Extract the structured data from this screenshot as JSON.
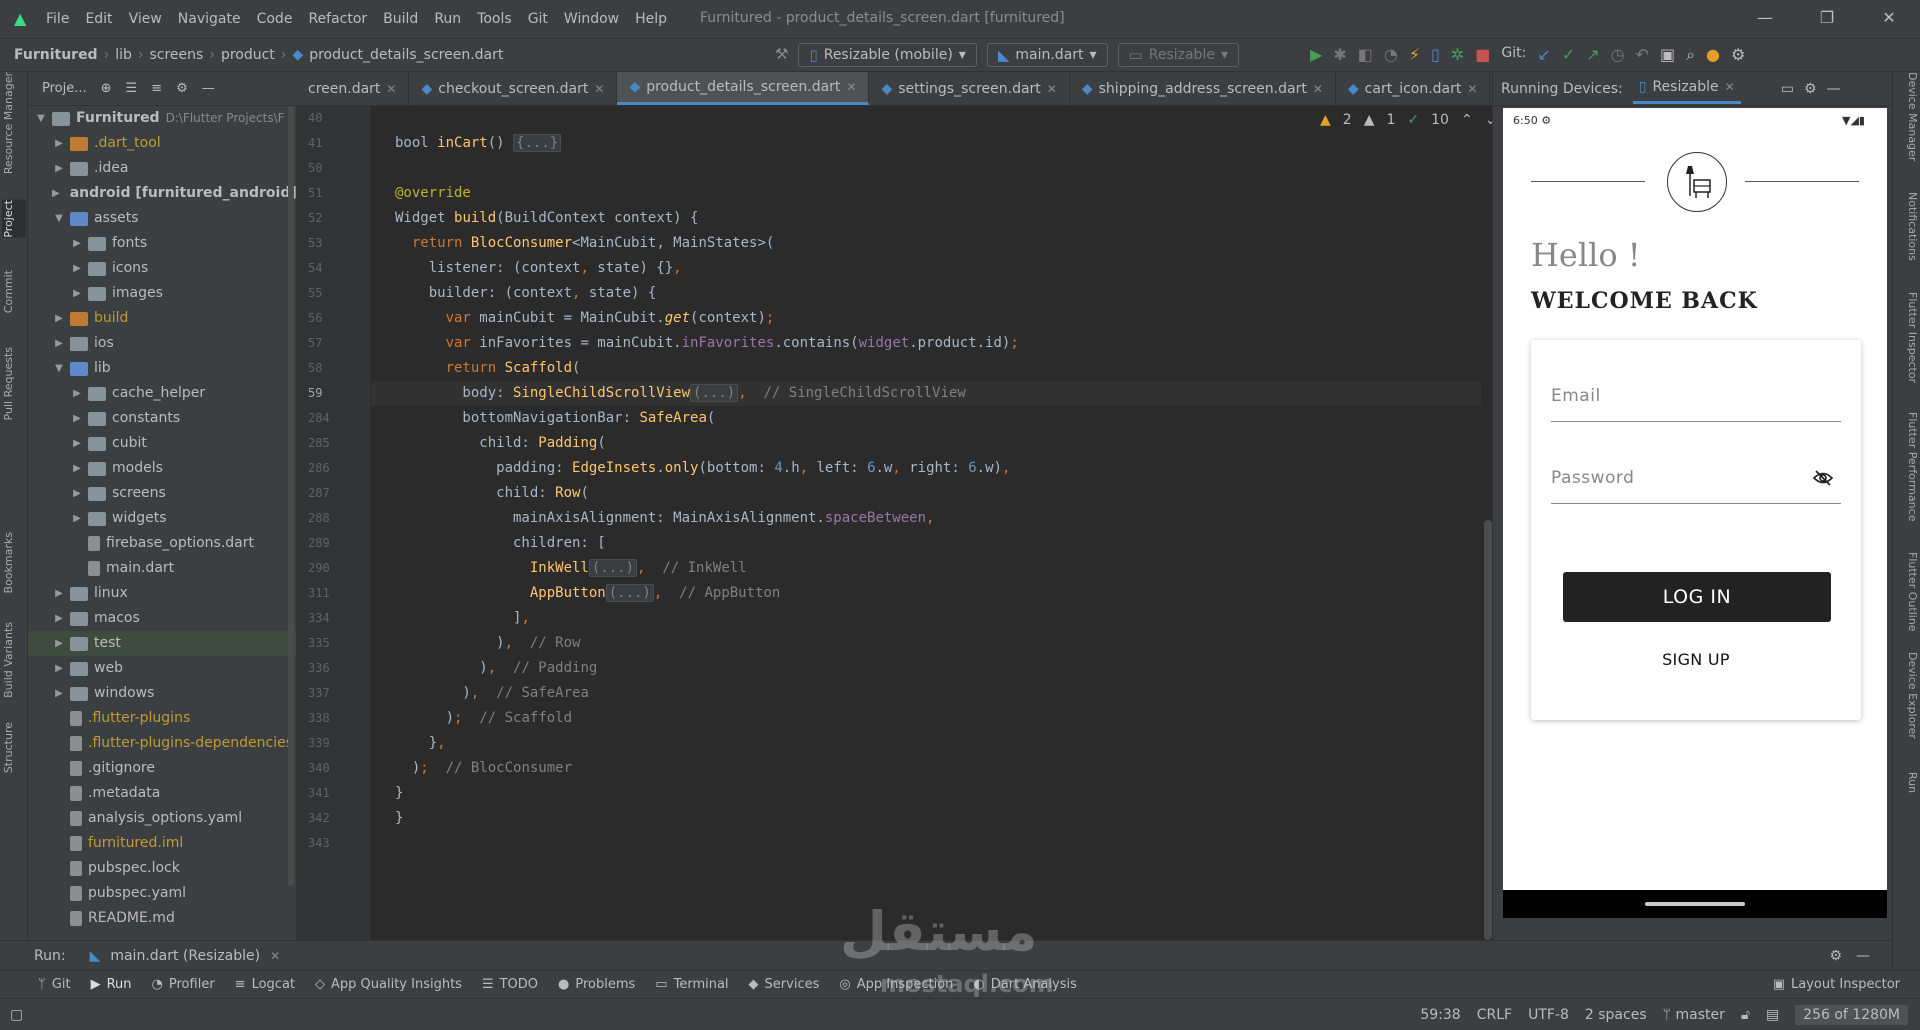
{
  "menu": [
    "File",
    "Edit",
    "View",
    "Navigate",
    "Code",
    "Refactor",
    "Build",
    "Run",
    "Tools",
    "Git",
    "Window",
    "Help"
  ],
  "window_title": "Furnitured - product_details_screen.dart [furnitured]",
  "breadcrumb": [
    "Furnitured",
    "lib",
    "screens",
    "product",
    "product_details_screen.dart"
  ],
  "toolbar": {
    "device": "Resizable (mobile)",
    "config": "main.dart",
    "device2": "Resizable",
    "git_label": "Git:"
  },
  "project_header": "Proje...",
  "tree": [
    {
      "label": "Furnitured",
      "extra": "D:\\Flutter Projects\\F",
      "indent": 0,
      "open": true,
      "bold": true
    },
    {
      "label": ".dart_tool",
      "indent": 1,
      "style": "yel"
    },
    {
      "label": ".idea",
      "indent": 1
    },
    {
      "label": "android [furnitured_android]",
      "indent": 1,
      "bold": true
    },
    {
      "label": "assets",
      "indent": 1,
      "open": true
    },
    {
      "label": "fonts",
      "indent": 2
    },
    {
      "label": "icons",
      "indent": 2
    },
    {
      "label": "images",
      "indent": 2
    },
    {
      "label": "build",
      "indent": 1,
      "style": "yel"
    },
    {
      "label": "ios",
      "indent": 1
    },
    {
      "label": "lib",
      "indent": 1,
      "open": true
    },
    {
      "label": "cache_helper",
      "indent": 2
    },
    {
      "label": "constants",
      "indent": 2
    },
    {
      "label": "cubit",
      "indent": 2
    },
    {
      "label": "models",
      "indent": 2
    },
    {
      "label": "screens",
      "indent": 2
    },
    {
      "label": "widgets",
      "indent": 2
    },
    {
      "label": "firebase_options.dart",
      "indent": 2,
      "file": true
    },
    {
      "label": "main.dart",
      "indent": 2,
      "file": true
    },
    {
      "label": "linux",
      "indent": 1
    },
    {
      "label": "macos",
      "indent": 1
    },
    {
      "label": "test",
      "indent": 1,
      "style": "hl"
    },
    {
      "label": "web",
      "indent": 1
    },
    {
      "label": "windows",
      "indent": 1
    },
    {
      "label": ".flutter-plugins",
      "indent": 1,
      "file": true,
      "style": "yel"
    },
    {
      "label": ".flutter-plugins-dependencies",
      "indent": 1,
      "file": true,
      "style": "yel"
    },
    {
      "label": ".gitignore",
      "indent": 1,
      "file": true
    },
    {
      "label": ".metadata",
      "indent": 1,
      "file": true
    },
    {
      "label": "analysis_options.yaml",
      "indent": 1,
      "file": true
    },
    {
      "label": "furnitured.iml",
      "indent": 1,
      "file": true,
      "style": "yel"
    },
    {
      "label": "pubspec.lock",
      "indent": 1,
      "file": true
    },
    {
      "label": "pubspec.yaml",
      "indent": 1,
      "file": true
    },
    {
      "label": "README.md",
      "indent": 1,
      "file": true
    }
  ],
  "tabs": [
    "creen.dart",
    "checkout_screen.dart",
    "product_details_screen.dart",
    "settings_screen.dart",
    "shipping_address_screen.dart",
    "cart_icon.dart"
  ],
  "active_tab": 2,
  "inspections": {
    "warn": "2",
    "weak": "1",
    "ok": "10"
  },
  "line_numbers": [
    "40",
    "41",
    "50",
    "51",
    "52",
    "53",
    "54",
    "55",
    "56",
    "57",
    "58",
    "59",
    "284",
    "285",
    "286",
    "287",
    "288",
    "289",
    "290",
    "311",
    "334",
    "335",
    "336",
    "337",
    "338",
    "339",
    "340",
    "341",
    "342",
    "343"
  ],
  "current_line": "59",
  "code_lines": [
    [],
    [
      [
        "",
        "bool "
      ],
      [
        "fn",
        "inCart"
      ],
      [
        "",
        "() "
      ],
      [
        "fold",
        "{...}"
      ]
    ],
    [],
    [
      [
        "an",
        "@override"
      ]
    ],
    [
      [
        "",
        "Widget "
      ],
      [
        "fn",
        "build"
      ],
      [
        "",
        "(BuildContext context) {"
      ]
    ],
    [
      [
        "",
        "  "
      ],
      [
        "kw",
        "return "
      ],
      [
        "fn",
        "BlocConsumer"
      ],
      [
        "",
        "<MainCubit, MainStates>("
      ]
    ],
    [
      [
        "",
        "    listener: (context"
      ],
      [
        "kw",
        ", "
      ],
      [
        "",
        "state) {}"
      ],
      [
        "kw",
        ","
      ]
    ],
    [
      [
        "",
        "    builder: (context"
      ],
      [
        "kw",
        ", "
      ],
      [
        "",
        "state) {"
      ]
    ],
    [
      [
        "",
        "      "
      ],
      [
        "kw",
        "var "
      ],
      [
        "",
        "mainCubit = MainCubit."
      ],
      [
        "mb",
        "get"
      ],
      [
        "",
        "(context)"
      ],
      [
        "kw",
        ";"
      ]
    ],
    [
      [
        "",
        "      "
      ],
      [
        "kw",
        "var "
      ],
      [
        "",
        "inFavorites = mainCubit."
      ],
      [
        "fd",
        "inFavorites"
      ],
      [
        "",
        ".contains("
      ],
      [
        "fd",
        "widget"
      ],
      [
        "",
        ".product.id)"
      ],
      [
        "kw",
        ";"
      ]
    ],
    [
      [
        "",
        "      "
      ],
      [
        "kw",
        "return "
      ],
      [
        "fn",
        "Scaffold"
      ],
      [
        "",
        "("
      ]
    ],
    [
      [
        "",
        "        body: "
      ],
      [
        "fn",
        "SingleChildScrollView"
      ],
      [
        "fold",
        "(...)"
      ],
      [
        "kw",
        ",  "
      ],
      [
        "cm",
        "// SingleChildScrollView"
      ]
    ],
    [
      [
        "",
        "        bottomNavigationBar: "
      ],
      [
        "fn",
        "SafeArea"
      ],
      [
        "",
        "("
      ]
    ],
    [
      [
        "",
        "          child: "
      ],
      [
        "fn",
        "Padding"
      ],
      [
        "",
        "("
      ]
    ],
    [
      [
        "",
        "            padding: "
      ],
      [
        "fn",
        "EdgeInsets"
      ],
      [
        "",
        "."
      ],
      [
        "fn",
        "only"
      ],
      [
        "",
        "(bottom: "
      ],
      [
        "num",
        "4"
      ],
      [
        "",
        ".h"
      ],
      [
        "kw",
        ", "
      ],
      [
        "",
        "left: "
      ],
      [
        "num",
        "6"
      ],
      [
        "",
        ".w"
      ],
      [
        "kw",
        ", "
      ],
      [
        "",
        "right: "
      ],
      [
        "num",
        "6"
      ],
      [
        "",
        ".w)"
      ],
      [
        "kw",
        ","
      ]
    ],
    [
      [
        "",
        "            child: "
      ],
      [
        "fn",
        "Row"
      ],
      [
        "",
        "("
      ]
    ],
    [
      [
        "",
        "              mainAxisAlignment: MainAxisAlignment."
      ],
      [
        "fd",
        "spaceBetween"
      ],
      [
        "kw",
        ","
      ]
    ],
    [
      [
        "",
        "              children: ["
      ]
    ],
    [
      [
        "",
        "                "
      ],
      [
        "fn",
        "InkWell"
      ],
      [
        "fold",
        "(...)"
      ],
      [
        "kw",
        ",  "
      ],
      [
        "cm",
        "// InkWell"
      ]
    ],
    [
      [
        "",
        "                "
      ],
      [
        "fn",
        "AppButton"
      ],
      [
        "fold",
        "(...)"
      ],
      [
        "kw",
        ",  "
      ],
      [
        "cm",
        "// AppButton"
      ]
    ],
    [
      [
        "",
        "              ]"
      ],
      [
        "kw",
        ","
      ]
    ],
    [
      [
        "",
        "            )"
      ],
      [
        "kw",
        ",  "
      ],
      [
        "cm",
        "// Row"
      ]
    ],
    [
      [
        "",
        "          )"
      ],
      [
        "kw",
        ",  "
      ],
      [
        "cm",
        "// Padding"
      ]
    ],
    [
      [
        "",
        "        )"
      ],
      [
        "kw",
        ",  "
      ],
      [
        "cm",
        "// SafeArea"
      ]
    ],
    [
      [
        "",
        "      )"
      ],
      [
        "kw",
        ";  "
      ],
      [
        "cm",
        "// Scaffold"
      ]
    ],
    [
      [
        "",
        "    }"
      ],
      [
        "kw",
        ","
      ]
    ],
    [
      [
        "",
        "  )"
      ],
      [
        "kw",
        ";  "
      ],
      [
        "cm",
        "// BlocConsumer"
      ]
    ],
    [
      [
        "",
        "}"
      ]
    ],
    [
      [
        "",
        "}"
      ]
    ],
    []
  ],
  "running_devices": {
    "label": "Running Devices:",
    "tab": "Resizable"
  },
  "phone": {
    "time": "6:50",
    "hello": "Hello !",
    "welcome": "WELCOME BACK",
    "email_placeholder": "Email",
    "password_placeholder": "Password",
    "login": "LOG IN",
    "signup": "SIGN UP"
  },
  "left_tools": [
    "Resource Manager",
    "Project",
    "Commit",
    "Pull Requests",
    "Bookmarks",
    "Build Variants",
    "Structure"
  ],
  "right_tools": [
    "Device Manager",
    "Notifications",
    "Flutter Inspector",
    "Flutter Performance",
    "Flutter Outline",
    "Device Explorer",
    "Run"
  ],
  "run_bar": {
    "label": "Run:",
    "config": "main.dart (Resizable)"
  },
  "bottom_tools": [
    "Git",
    "Run",
    "Profiler",
    "Logcat",
    "App Quality Insights",
    "TODO",
    "Problems",
    "Terminal",
    "Services",
    "App Inspection",
    "Dart Analysis"
  ],
  "layout_inspector": "Layout Inspector",
  "statusbar": {
    "pos": "59:38",
    "eol": "CRLF",
    "enc": "UTF-8",
    "indent": "2 spaces",
    "branch": "master",
    "mem": "256 of 1280M"
  },
  "watermark": {
    "arabic": "مستقل",
    "latin": "mostaql.com"
  },
  "colors": {
    "accent": "#4a88c7",
    "editor_bg": "#2b2b2b",
    "panel_bg": "#3c3f41"
  }
}
